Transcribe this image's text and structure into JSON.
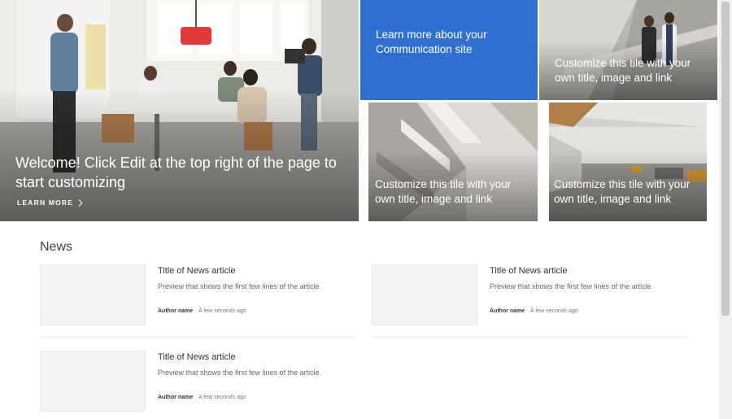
{
  "hero": {
    "main": {
      "title": "Welcome! Click Edit at the top right of the page to start customizing",
      "link_label": "LEARN MORE"
    },
    "tiles": [
      {
        "caption": "Learn more about your Communication site"
      },
      {
        "caption": "Customize this tile with your own title, image and link"
      },
      {
        "caption": "Customize this tile with your own title, image and link"
      },
      {
        "caption": "Customize this tile with your own title, image and link"
      }
    ],
    "colors": {
      "blue_tile": "#2f6fd1"
    }
  },
  "news": {
    "heading": "News",
    "articles": [
      {
        "title": "Title of News article",
        "preview": "Preview that shows the first few lines of the article.",
        "author": "Author name",
        "time": "A few seconds ago"
      },
      {
        "title": "Title of News article",
        "preview": "Preview that shows the first few lines of the article.",
        "author": "Author name",
        "time": "A few seconds ago"
      },
      {
        "title": "Title of News article",
        "preview": "Preview that shows the first few lines of the article.",
        "author": "Author name",
        "time": "A few seconds ago"
      }
    ]
  }
}
